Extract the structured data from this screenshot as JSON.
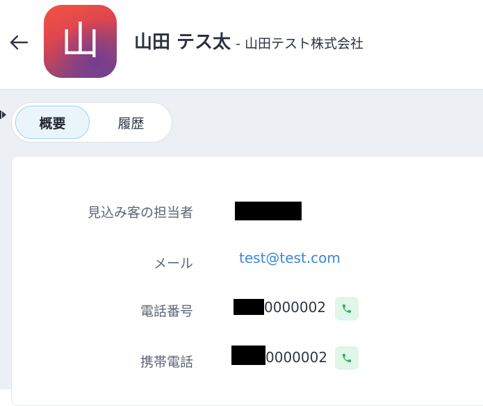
{
  "header": {
    "avatar_initial": "山",
    "person_name": "山田 テス太",
    "company": "- 山田テスト株式会社",
    "back_icon": "arrow-left-icon"
  },
  "tabs": [
    {
      "label": "概要",
      "active": true
    },
    {
      "label": "履歴",
      "active": false
    }
  ],
  "details": {
    "owner": {
      "label": "見込み客の担当者",
      "value_redacted": true
    },
    "email": {
      "label": "メール",
      "value": "test@test.com"
    },
    "phone": {
      "label": "電話番号",
      "value_suffix": "0000002",
      "icon": "phone-icon"
    },
    "mobile": {
      "label": "携帯電話",
      "value_suffix": "0000002",
      "icon": "phone-icon"
    }
  },
  "colors": {
    "accent_link": "#3b86d6",
    "call_button_bg": "#dff6e8",
    "call_icon": "#2bb05a",
    "page_bg": "#eceff3"
  }
}
